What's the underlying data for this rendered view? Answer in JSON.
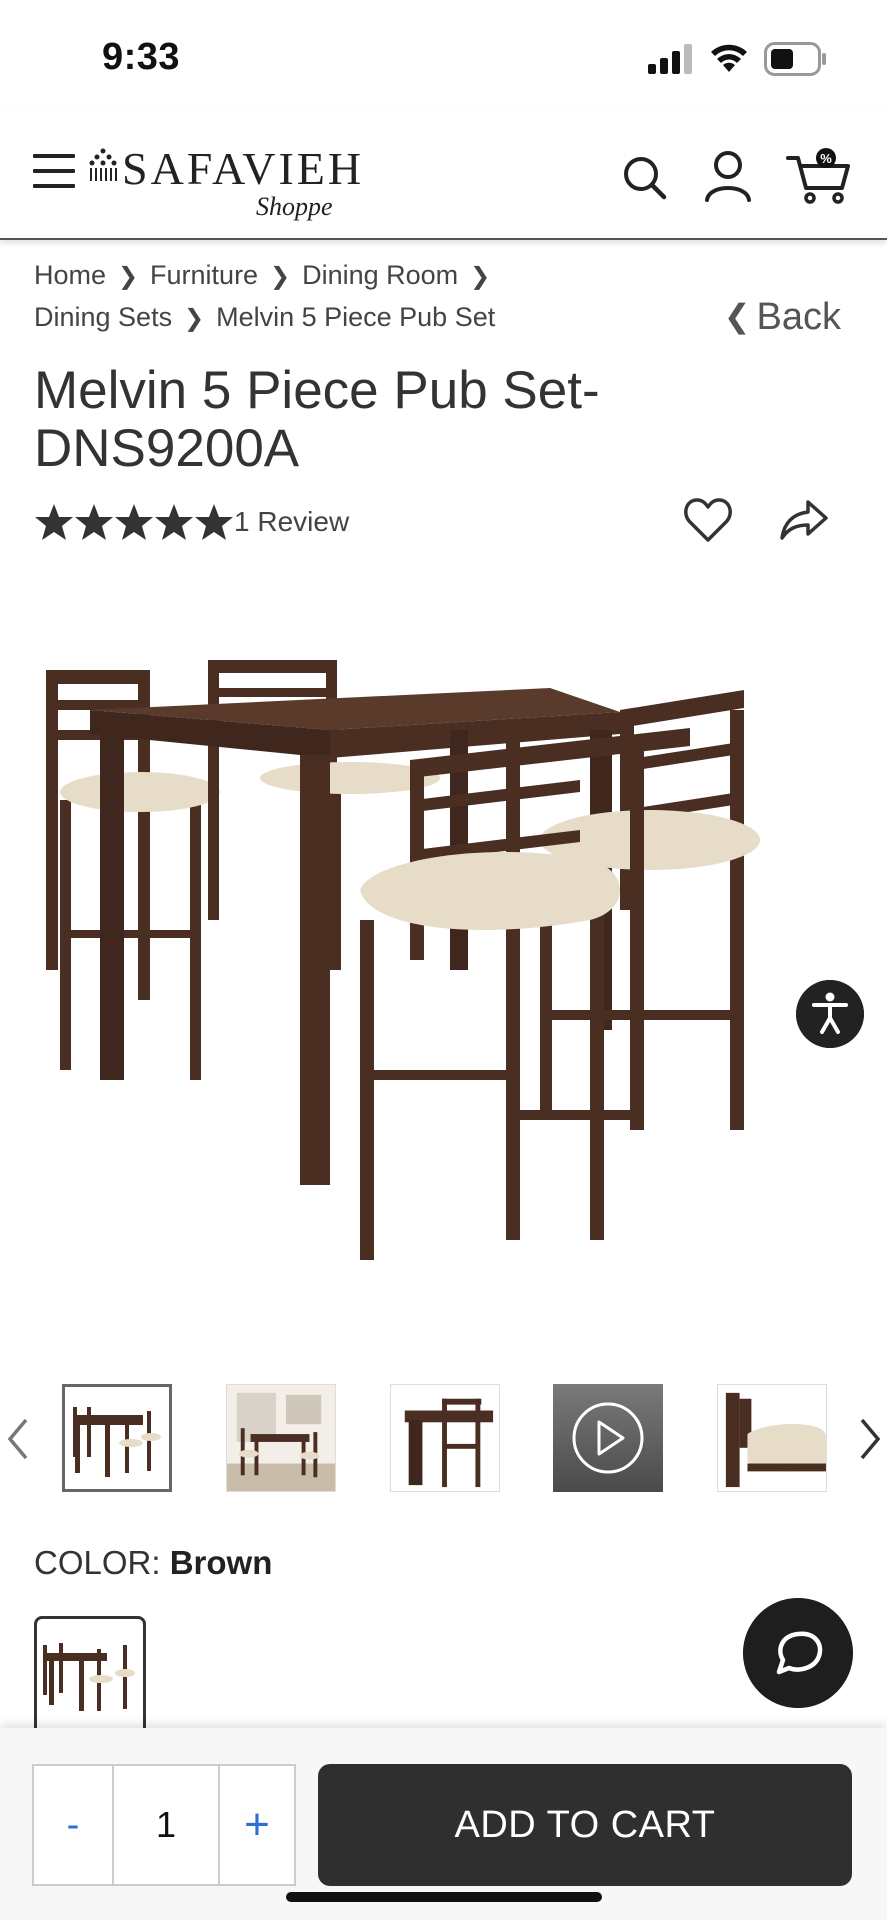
{
  "status_bar": {
    "time": "9:33"
  },
  "header": {
    "logo_text": "SAFAVIEH",
    "logo_subtext": "Shoppe",
    "cart_badge": "%"
  },
  "breadcrumb": {
    "items": [
      "Home",
      "Furniture",
      "Dining Room",
      "Dining Sets",
      "Melvin 5 Piece Pub Set"
    ],
    "back_label": "Back"
  },
  "product": {
    "title_line1": "Melvin 5 Piece Pub Set-",
    "title_line2": "DNS9200A",
    "rating": 5,
    "review_text": "1 Review",
    "color_label": "COLOR:",
    "color_value": "Brown"
  },
  "bottom_bar": {
    "minus_label": "-",
    "quantity": "1",
    "plus_label": "+",
    "add_to_cart_label": "ADD TO CART"
  },
  "icons": [
    "menu-icon",
    "search-icon",
    "user-icon",
    "cart-icon",
    "heart-icon",
    "share-icon",
    "accessibility-icon",
    "chat-icon",
    "play-icon"
  ],
  "colors": {
    "wood": "#4a2e22",
    "cushion": "#e6dcc8",
    "button_dark": "#2f2f2f",
    "qty_accent": "#2a6fd4"
  }
}
